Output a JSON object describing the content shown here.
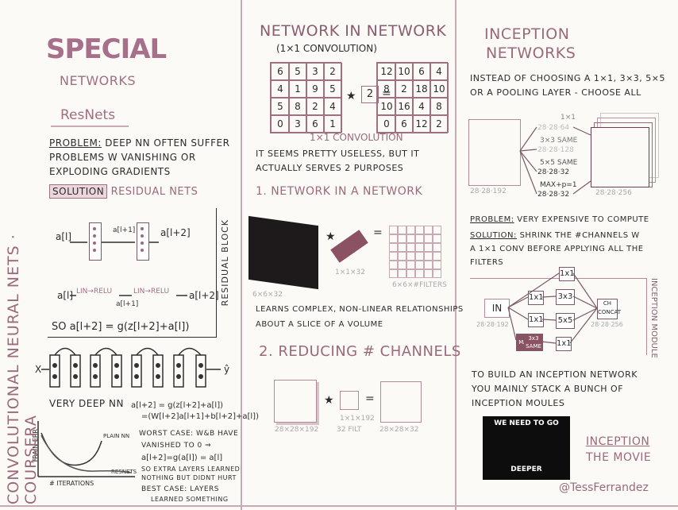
{
  "left": {
    "title": "SPECIAL",
    "subtitle": "NETWORKS",
    "resnets_heading": "ResNets",
    "problem_label": "PROBLEM:",
    "problem_text_1": "DEEP NN OFTEN SUFFER",
    "problem_text_2": "PROBLEMS W VANISHING OR",
    "problem_text_3": "EXPLODING GRADIENTS",
    "solution_label": "SOLUTION",
    "solution_text": "RESIDUAL NETS",
    "a_l": "a[l]",
    "a_l1": "a[l+1]",
    "a_l2": "a[l+2]",
    "lin_relu_1": "LIN→RELU",
    "lin_relu_2": "LIN→RELU",
    "residual_block": "RESIDUAL BLOCK",
    "so_eq": "SO a[l+2] = g(z[l+2]+a[l])",
    "x_label": "X",
    "y_label": "ŷ",
    "very_deep": "VERY DEEP NN",
    "eq_1": "a[l+2] = g(z[l+2]+a[l])",
    "eq_2": "=(W[l+2]a[l+1]+b[l+2]+a[l])",
    "worst_case": "WORST CASE: W&b HAVE",
    "vanished": "VANISHED TO 0 ⇒",
    "eq_3": "a[l+2]=g(a[l]) = a[l]",
    "extra_1": "SO EXTRA LAYERS LEARNED",
    "extra_2": "NOTHING BUT DIDNT HURT",
    "best_case": "BEST CASE: LAYERS",
    "learned": "LEARNED SOMETHING",
    "train_err": "TRAIN ERR",
    "plain_nn": "PLAIN NN",
    "resnets": "RESNETS",
    "iterations": "# ITERATIONS",
    "vertical": "CONVOLUTIONAL NEURAL NETS · COURSERA"
  },
  "middle": {
    "title": "NETWORK IN NETWORK",
    "subtitle": "(1×1 CONVOLUTION)",
    "grid_a": [
      [
        6,
        5,
        3,
        2
      ],
      [
        4,
        1,
        9,
        5
      ],
      [
        5,
        8,
        2,
        4
      ],
      [
        0,
        3,
        6,
        1
      ]
    ],
    "times": "★",
    "kernel": "2",
    "equals": "=",
    "grid_b": [
      [
        12,
        10,
        6,
        4
      ],
      [
        8,
        2,
        18,
        10
      ],
      [
        10,
        16,
        4,
        8
      ],
      [
        0,
        6,
        12,
        2
      ]
    ],
    "conv_label": "1×1 CONVOLUTION",
    "useless_1": "IT SEEMS PRETTY USELESS, BUT IT",
    "useless_2": "ACTUALLY SERVES 2 PURPOSES",
    "nin_heading": "1. NETWORK IN A NETWORK",
    "vol_label": "6×6×32",
    "filter_label": "1×1×32",
    "out_label": "6×6×#FILTERS",
    "learns_1": "LEARNS COMPLEX, NON-LINEAR RELATIONSHIPS",
    "learns_2": "ABOUT A SLICE OF A VOLUME",
    "reduce_heading": "2. REDUCING # CHANNELS",
    "in_size": "28×28×192",
    "filt_size": "1×1×192",
    "filt_count": "32 FILT",
    "out_size": "28×28×32"
  },
  "right": {
    "title_1": "INCEPTION",
    "title_2": "NETWORKS",
    "instead_1": "INSTEAD OF CHOOSING A 1×1, 3×3, 5×5",
    "instead_2": "OR A POOLING LAYER - CHOOSE ALL",
    "in_size": "28·28·192",
    "f1": "1×1",
    "f1_out": "28·28·64",
    "f3": "3×3 SAME",
    "f3_out": "28·28·128",
    "f5": "5×5 SAME",
    "f5_out": "28·28·32",
    "fmax": "MAX+p=1",
    "fmax_out": "28·28·32",
    "out_size": "28·28·256",
    "problem_label": "PROBLEM:",
    "problem_text": "VERY EXPENSIVE TO COMPUTE",
    "solution_label": "SOLUTION:",
    "solution_1": "SHRINK THE #CHANNELS W",
    "solution_2": "A 1×1 CONV BEFORE APPLYING ALL THE",
    "solution_3": "FILTERS",
    "in_label": "IN",
    "in_dims": "28·28·192",
    "k1": "1x1",
    "k3": "3x3",
    "k5": "5x5",
    "max": "MAX",
    "k3same": "3x3 SAME",
    "concat": "CH CONCAT",
    "out_dims": "28·28·256",
    "module_label": "INCEPTION MODULE",
    "build_1": "TO BUILD AN INCEPTION NETWORK",
    "build_2": "YOU MAINLY STACK A BUNCH OF",
    "build_3": "INCEPTION MOULES",
    "movie_top": "WE NEED TO GO",
    "movie_bottom": "DEEPER",
    "inception_movie_1": "INCEPTION",
    "inception_movie_2": "THE MOVIE",
    "credit": "@TessFerrandez"
  }
}
